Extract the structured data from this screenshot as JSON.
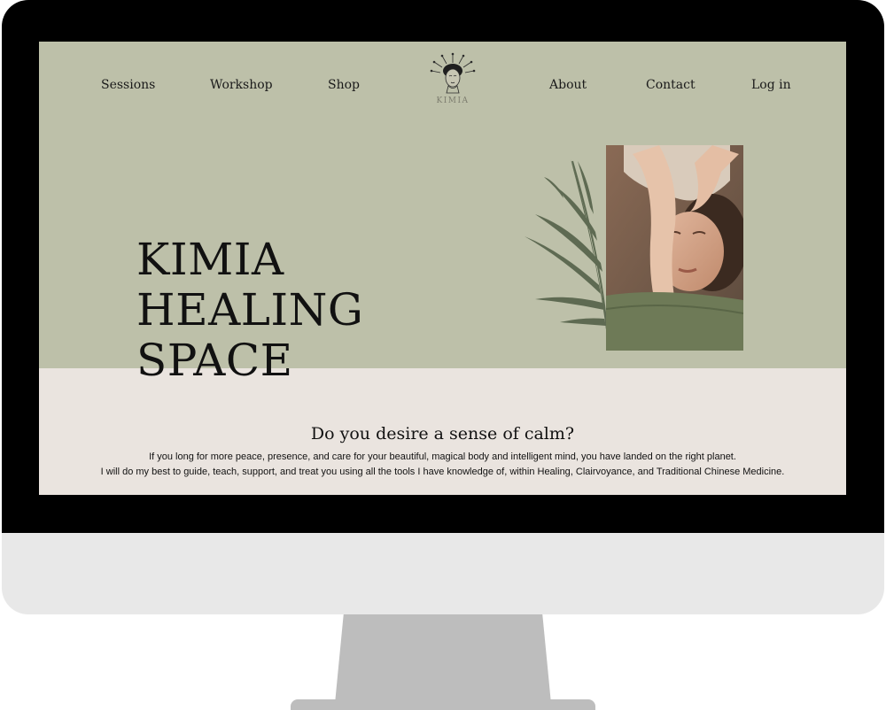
{
  "nav": {
    "left": [
      "Sessions",
      "Workshop",
      "Shop"
    ],
    "right": [
      "About",
      "Contact",
      "Log in"
    ]
  },
  "logo": {
    "text": "KIMIA"
  },
  "hero": {
    "title_lines": [
      "KIMIA",
      "HEALING",
      "SPACE"
    ]
  },
  "intro": {
    "heading": "Do you desire a sense of calm?",
    "line1": "If you long for more peace, presence, and care for your beautiful, magical body and intelligent mind, you have landed on the right planet.",
    "line2": "I will do my best to guide, teach, support, and treat you using all the tools I have knowledge of, within Healing, Clairvoyance, and Traditional Chinese Medicine."
  },
  "colors": {
    "hero_bg": "#bdc0a9",
    "section_bg": "#eae4df",
    "leaf": "#5e6a52",
    "bezel": "#000000",
    "chin": "#e8e8e8",
    "stand": "#bdbdbd"
  }
}
